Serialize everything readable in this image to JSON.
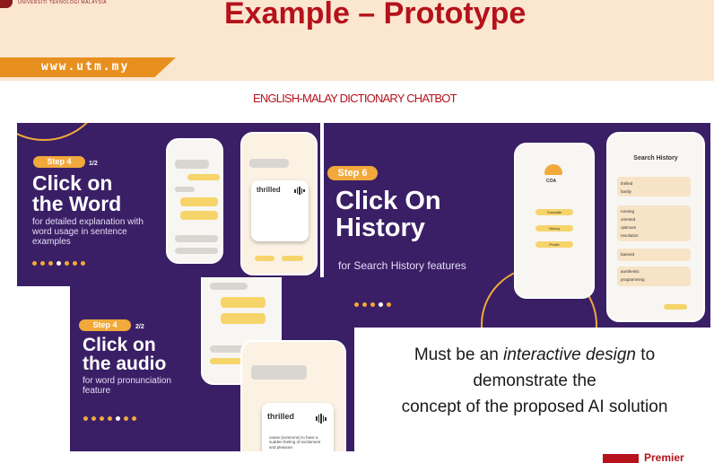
{
  "header": {
    "logo_text": "UNIVERSITI TEKNOLOGI MALAYSIA",
    "title": "Example – Prototype",
    "url": "www.utm.my",
    "subtitle": "ENGLISH-MALAY DICTIONARY CHATBOT"
  },
  "panels": {
    "word": {
      "step": "Step 4",
      "frac": "1/2",
      "heading_line1": "Click on",
      "heading_line2": "the Word",
      "desc": "for detailed explanation with word usage in sentence examples",
      "card_word": "thrilled"
    },
    "history": {
      "step": "Step 6",
      "heading_line1": "Click On",
      "heading_line2": "History",
      "desc": "for Search History features",
      "phone_title": "Search History",
      "menu": [
        "Translate",
        "History",
        "Profile"
      ],
      "logo": "COA",
      "items": [
        "thrilled",
        "family",
        "running",
        "oriented",
        "optimum",
        "resolution",
        "banned",
        "aunthentic",
        "programming"
      ]
    },
    "audio": {
      "step": "Step 4",
      "frac": "2/2",
      "heading_line1": "Click on",
      "heading_line2": "the audio",
      "desc": "for word pronunciation feature",
      "card_word": "thrilled",
      "card_def": "cause (someone) to have a sudden feeling of excitement and pleasure."
    }
  },
  "caption": {
    "line1_pre": "Must be an ",
    "line1_em": "interactive design",
    "line1_post": " to",
    "line2": "demonstrate the",
    "line3": "concept of the proposed AI solution"
  },
  "footer": {
    "premier": "Premier"
  },
  "colors": {
    "brand_red": "#b5121b",
    "panel_purple": "#3a1f66",
    "accent_orange": "#f2a93b",
    "header_cream": "#fbe6d0"
  }
}
